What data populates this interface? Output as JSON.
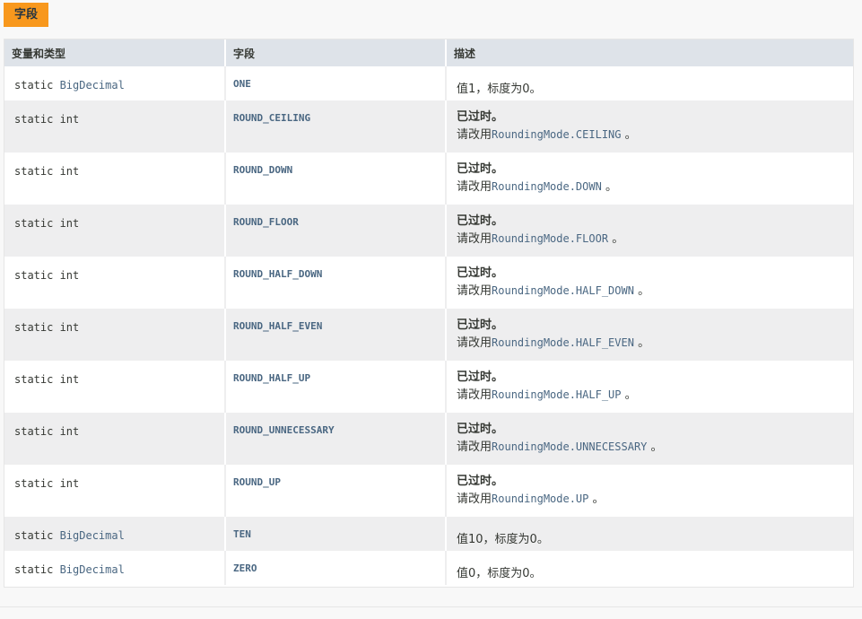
{
  "caption": "字段",
  "headers": [
    "变量和类型",
    "字段",
    "描述"
  ],
  "rows": [
    {
      "mod": "static ",
      "type": "BigDecimal",
      "field": "ONE",
      "desc": "值1，标度为0。"
    },
    {
      "mod": "static int",
      "type": "",
      "field": "ROUND_CEILING",
      "deprecated": "已过时。",
      "use": "请改用",
      "code": "RoundingMode.CEILING",
      "end": " 。"
    },
    {
      "mod": "static int",
      "type": "",
      "field": "ROUND_DOWN",
      "deprecated": "已过时。",
      "use": "请改用",
      "code": "RoundingMode.DOWN",
      "end": " 。"
    },
    {
      "mod": "static int",
      "type": "",
      "field": "ROUND_FLOOR",
      "deprecated": "已过时。",
      "use": "请改用",
      "code": "RoundingMode.FLOOR",
      "end": " 。"
    },
    {
      "mod": "static int",
      "type": "",
      "field": "ROUND_HALF_DOWN",
      "deprecated": "已过时。",
      "use": "请改用",
      "code": "RoundingMode.HALF_DOWN",
      "end": " 。"
    },
    {
      "mod": "static int",
      "type": "",
      "field": "ROUND_HALF_EVEN",
      "deprecated": "已过时。",
      "use": "请改用",
      "code": "RoundingMode.HALF_EVEN",
      "end": " 。"
    },
    {
      "mod": "static int",
      "type": "",
      "field": "ROUND_HALF_UP",
      "deprecated": "已过时。",
      "use": "请改用",
      "code": "RoundingMode.HALF_UP",
      "end": " 。"
    },
    {
      "mod": "static int",
      "type": "",
      "field": "ROUND_UNNECESSARY",
      "deprecated": "已过时。",
      "use": "请改用",
      "code": "RoundingMode.UNNECESSARY",
      "end": " 。"
    },
    {
      "mod": "static int",
      "type": "",
      "field": "ROUND_UP",
      "deprecated": "已过时。",
      "use": "请改用",
      "code": "RoundingMode.UP",
      "end": " 。"
    },
    {
      "mod": "static ",
      "type": "BigDecimal",
      "field": "TEN",
      "desc": "值10，标度为0。"
    },
    {
      "mod": "static ",
      "type": "BigDecimal",
      "field": "ZERO",
      "desc": "值0，标度为0。"
    }
  ]
}
